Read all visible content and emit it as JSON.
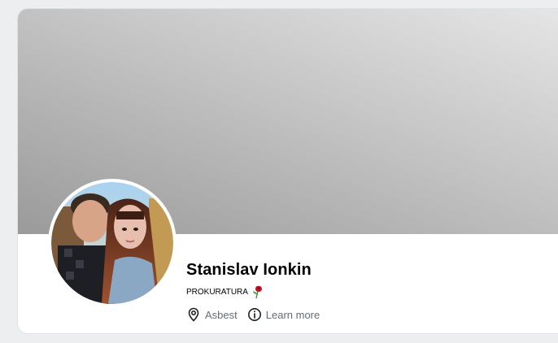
{
  "profile": {
    "name": "Stanislav Ionkin",
    "status": "PROKURATURA",
    "status_emoji": "rose-icon",
    "location": "Asbest",
    "learn_more": "Learn more"
  },
  "icons": {
    "location": "location-pin-icon",
    "info": "info-circle-icon"
  },
  "colors": {
    "page_background": "#edeef0",
    "card_background": "#ffffff",
    "meta_text": "#626d7a",
    "name_text": "#000000"
  }
}
